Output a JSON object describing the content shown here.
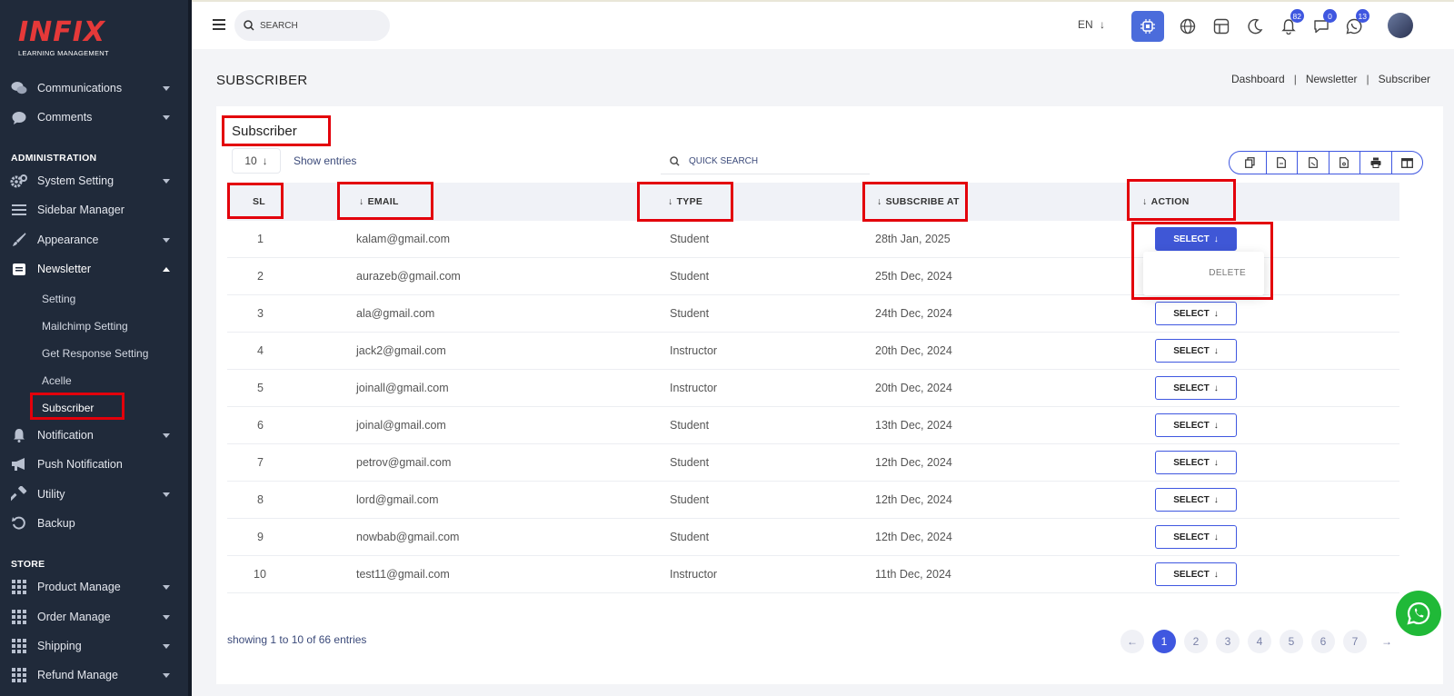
{
  "sidebar": {
    "logo_main": "INFIX",
    "logo_sub": "LEARNING MANAGEMENT",
    "items_top": [
      {
        "label": "Communications"
      },
      {
        "label": "Comments"
      }
    ],
    "section_admin": "ADMINISTRATION",
    "items_admin": [
      {
        "label": "System Setting"
      },
      {
        "label": "Sidebar Manager"
      },
      {
        "label": "Appearance"
      },
      {
        "label": "Newsletter"
      }
    ],
    "newsletter_sub": [
      {
        "label": "Setting"
      },
      {
        "label": "Mailchimp Setting"
      },
      {
        "label": "Get Response Setting"
      },
      {
        "label": "Acelle"
      },
      {
        "label": "Subscriber"
      }
    ],
    "items_after": [
      {
        "label": "Notification"
      },
      {
        "label": "Push Notification"
      },
      {
        "label": "Utility"
      },
      {
        "label": "Backup"
      }
    ],
    "section_store": "STORE",
    "items_store": [
      {
        "label": "Product Manage"
      },
      {
        "label": "Order Manage"
      },
      {
        "label": "Shipping"
      },
      {
        "label": "Refund Manage"
      }
    ]
  },
  "topbar": {
    "search_placeholder": "SEARCH",
    "language": "EN",
    "notifications_count": "82",
    "messages_count": "0",
    "whatsapp_count": "13"
  },
  "page": {
    "title": "SUBSCRIBER",
    "breadcrumb": [
      "Dashboard",
      "Newsletter",
      "Subscriber"
    ]
  },
  "card": {
    "title": "Subscriber",
    "entries_value": "10",
    "entries_label": "Show entries",
    "quick_search_placeholder": "QUICK SEARCH",
    "columns": {
      "sl": "SL",
      "email": "EMAIL",
      "type": "TYPE",
      "subscribe_at": "SUBSCRIBE AT",
      "action": "ACTION"
    },
    "select_label": "SELECT",
    "dropdown_delete": "DELETE",
    "rows": [
      {
        "sl": "1",
        "email": "kalam@gmail.com",
        "type": "Student",
        "date": "28th Jan, 2025"
      },
      {
        "sl": "2",
        "email": "aurazeb@gmail.com",
        "type": "Student",
        "date": "25th Dec, 2024"
      },
      {
        "sl": "3",
        "email": "ala@gmail.com",
        "type": "Student",
        "date": "24th Dec, 2024"
      },
      {
        "sl": "4",
        "email": "jack2@gmail.com",
        "type": "Instructor",
        "date": "20th Dec, 2024"
      },
      {
        "sl": "5",
        "email": "joinall@gmail.com",
        "type": "Instructor",
        "date": "20th Dec, 2024"
      },
      {
        "sl": "6",
        "email": "joinal@gmail.com",
        "type": "Student",
        "date": "13th Dec, 2024"
      },
      {
        "sl": "7",
        "email": "petrov@gmail.com",
        "type": "Student",
        "date": "12th Dec, 2024"
      },
      {
        "sl": "8",
        "email": "lord@gmail.com",
        "type": "Student",
        "date": "12th Dec, 2024"
      },
      {
        "sl": "9",
        "email": "nowbab@gmail.com",
        "type": "Student",
        "date": "12th Dec, 2024"
      },
      {
        "sl": "10",
        "email": "test11@gmail.com",
        "type": "Instructor",
        "date": "11th Dec, 2024"
      }
    ],
    "showing_text": "showing 1 to 10 of 66 entries",
    "pages": [
      "1",
      "2",
      "3",
      "4",
      "5",
      "6",
      "7"
    ],
    "current_page": "1"
  },
  "colors": {
    "accent": "#3f57e0",
    "sidebar_bg": "#202a3a",
    "highlight_box": "#e3000b",
    "whatsapp": "#20b938"
  }
}
